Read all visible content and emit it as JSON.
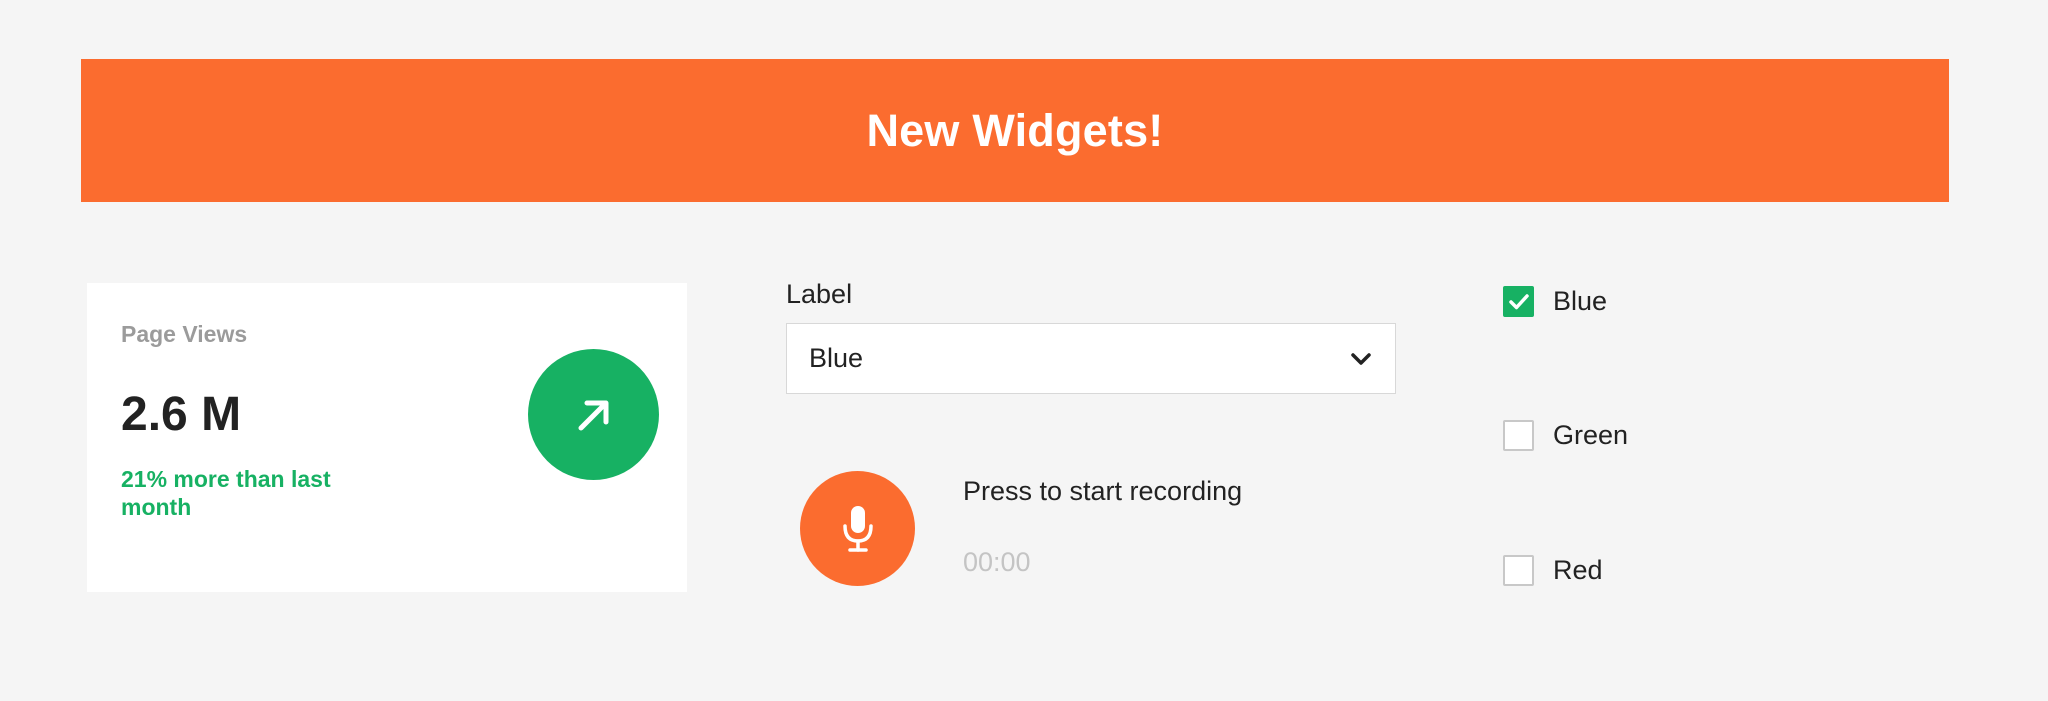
{
  "banner": {
    "title": "New Widgets!"
  },
  "stat_card": {
    "label": "Page Views",
    "value": "2.6 M",
    "change_text": "21% more than last month",
    "trend_icon": "arrow-up-right-icon",
    "accent_color": "#17b163"
  },
  "select_field": {
    "label": "Label",
    "selected_value": "Blue",
    "icon": "chevron-down-icon"
  },
  "recorder": {
    "prompt": "Press to start recording",
    "timer": "00:00",
    "icon": "microphone-icon",
    "color": "#fb6c2f"
  },
  "checkboxes": [
    {
      "label": "Blue",
      "checked": true
    },
    {
      "label": "Green",
      "checked": false
    },
    {
      "label": "Red",
      "checked": false
    }
  ],
  "colors": {
    "brand_orange": "#fb6c2f",
    "success_green": "#17b163",
    "background": "#f5f5f5"
  }
}
